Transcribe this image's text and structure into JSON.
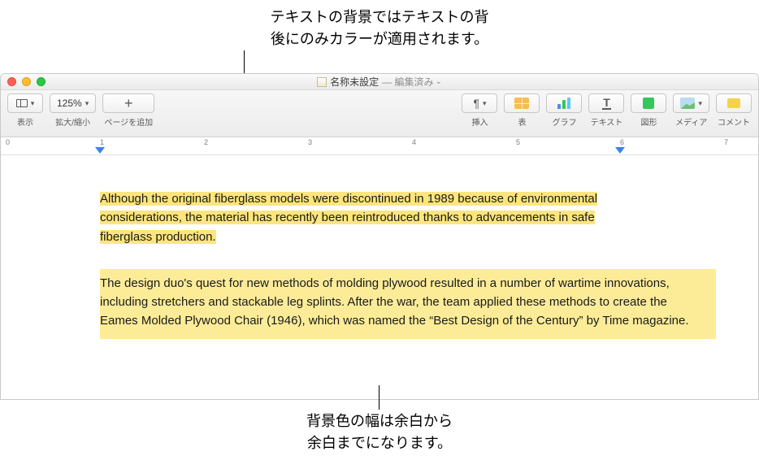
{
  "annotation_top": {
    "line1": "テキストの背景ではテキストの背",
    "line2": "後にのみカラーが適用されます。"
  },
  "annotation_bottom": {
    "line1": "背景色の幅は余白から",
    "line2": "余白までになります。"
  },
  "titlebar": {
    "docname": "名称未設定",
    "edited": "— 編集済み"
  },
  "toolbar": {
    "view": "表示",
    "zoom_value": "125%",
    "zoom_label": "拡大/縮小",
    "addpage": "ページを追加",
    "insert": "挿入",
    "table": "表",
    "chart": "グラフ",
    "text": "テキスト",
    "shape": "図形",
    "media": "メディア",
    "comment": "コメント",
    "text_glyph": "T"
  },
  "ruler": {
    "nums": [
      "0",
      "1",
      "2",
      "3",
      "4",
      "5",
      "6",
      "7"
    ]
  },
  "document": {
    "para1": "Although the original fiberglass models were discontinued in 1989 because of environmental considerations, the material has recently been reintroduced thanks to advancements in safe fiberglass production.",
    "para2": "The design duo's quest for new methods of molding plywood resulted in a number of wartime innovations, including stretchers and stackable leg splints. After the war, the team applied these methods to create the Eames Molded Plywood Chair (1946), which was named the “Best Design of the Century” by Time magazine."
  }
}
